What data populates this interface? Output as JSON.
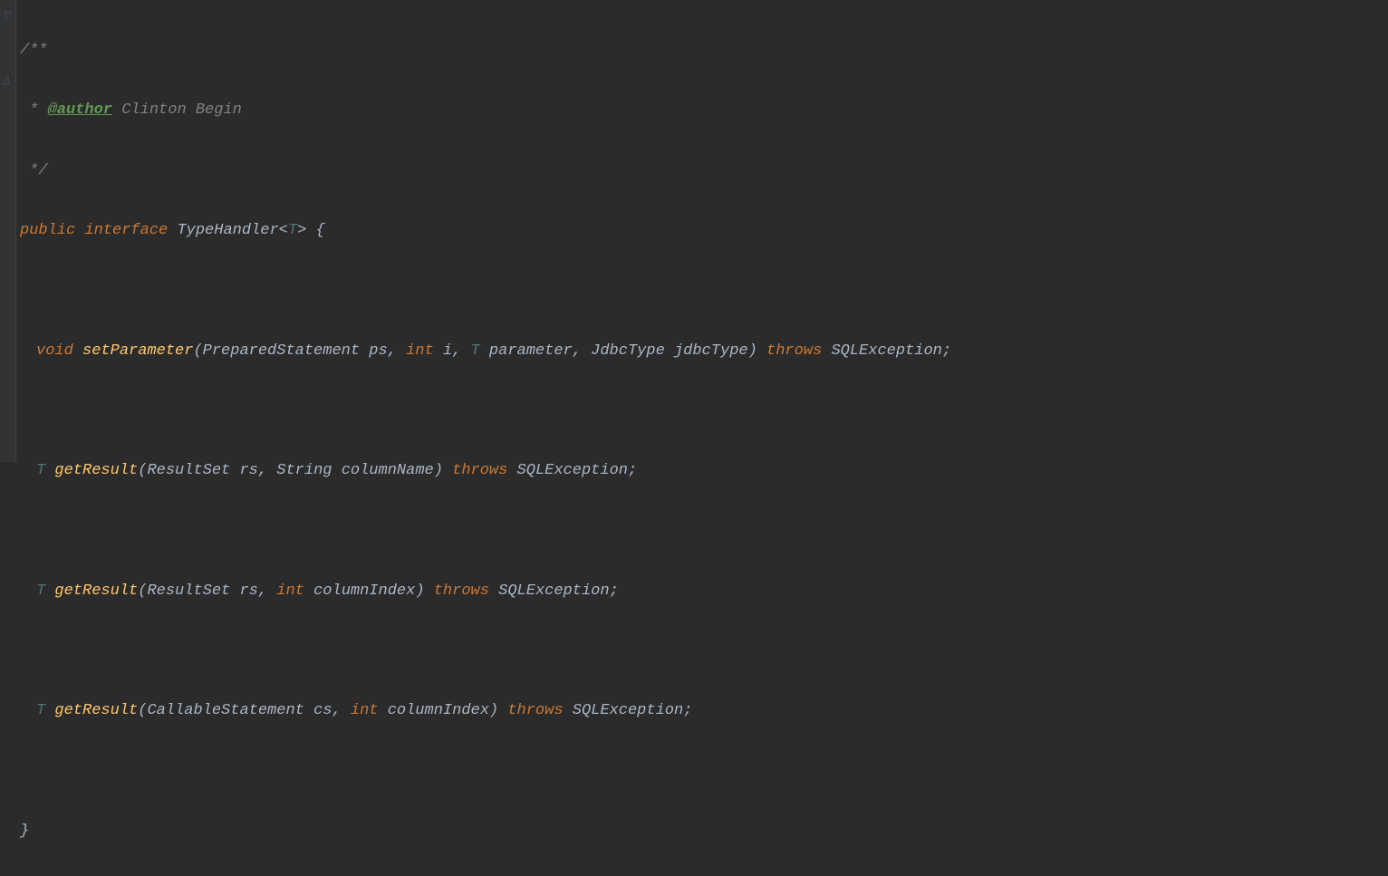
{
  "javadoc": {
    "open": "/**",
    "star": " * ",
    "tag": "@author",
    "author_name": " Clinton Begin",
    "close": " */"
  },
  "class_decl": {
    "kw_public": "public",
    "kw_interface": "interface",
    "name": "TypeHandler",
    "lt": "<",
    "tp": "T",
    "gt": ">",
    "open_brace": " {"
  },
  "m1": {
    "ret": "void",
    "name": "setParameter",
    "lp": "(",
    "p1t": "PreparedStatement",
    "p1n": " ps",
    "c1": ", ",
    "p2t": "int",
    "p2n": " i",
    "c2": ", ",
    "p3t": "T",
    "p3n": " parameter",
    "c3": ", ",
    "p4t": "JdbcType",
    "p4n": " jdbcType",
    "rp": ")",
    "kw_throws": "throws",
    "exc": "SQLException",
    "semi": ";"
  },
  "m2": {
    "ret": "T",
    "name": "getResult",
    "lp": "(",
    "p1t": "ResultSet",
    "p1n": " rs",
    "c1": ", ",
    "p2t": "String",
    "p2n": " columnName",
    "rp": ")",
    "kw_throws": "throws",
    "exc": "SQLException",
    "semi": ";"
  },
  "m3": {
    "ret": "T",
    "name": "getResult",
    "lp": "(",
    "p1t": "ResultSet",
    "p1n": " rs",
    "c1": ", ",
    "p2t": "int",
    "p2n": " columnIndex",
    "rp": ")",
    "kw_throws": "throws",
    "exc": "SQLException",
    "semi": ";"
  },
  "m4": {
    "ret": "T",
    "name": "getResult",
    "lp": "(",
    "p1t": "CallableStatement",
    "p1n": " cs",
    "c1": ", ",
    "p2t": "int",
    "p2n": " columnIndex",
    "rp": ")",
    "kw_throws": "throws",
    "exc": "SQLException",
    "semi": ";"
  },
  "close_brace": "}"
}
